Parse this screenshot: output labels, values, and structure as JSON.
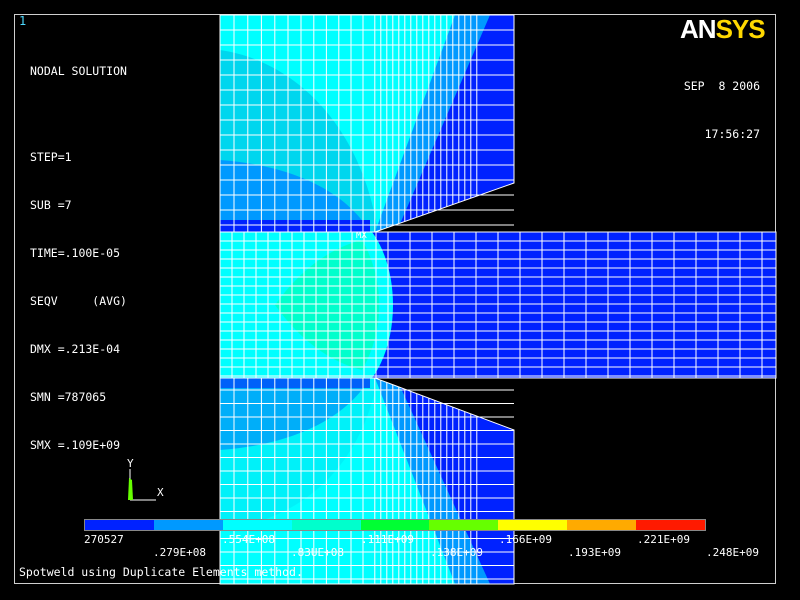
{
  "window_number": "1",
  "info": {
    "title": "NODAL SOLUTION",
    "lines": [
      "STEP=1",
      "SUB =7",
      "TIME=.100E-05",
      "SEQV     (AVG)",
      "DMX =.213E-04",
      "SMN =787065",
      "SMX =.109E+09"
    ]
  },
  "logo": {
    "part1": "AN",
    "part2": "SYS"
  },
  "date": "SEP  8 2006",
  "time": "17:56:27",
  "mx_label": "MX",
  "triad": {
    "y": "Y",
    "x": "X"
  },
  "legend": {
    "colors": [
      "#0022ff",
      "#0099ff",
      "#00ffff",
      "#00ffcc",
      "#00ff33",
      "#66ff00",
      "#ffff00",
      "#ffaa00",
      "#ff1a00"
    ],
    "labels_top_row": [
      "270527",
      ".554E+08",
      ".111E+09",
      ".166E+09",
      ".221E+09"
    ],
    "labels_bottom_row": [
      ".279E+08",
      ".83UE+08",
      ".138E+09",
      ".193E+09",
      ".248E+09"
    ]
  },
  "footer": "Spotweld using Duplicate Elements method."
}
